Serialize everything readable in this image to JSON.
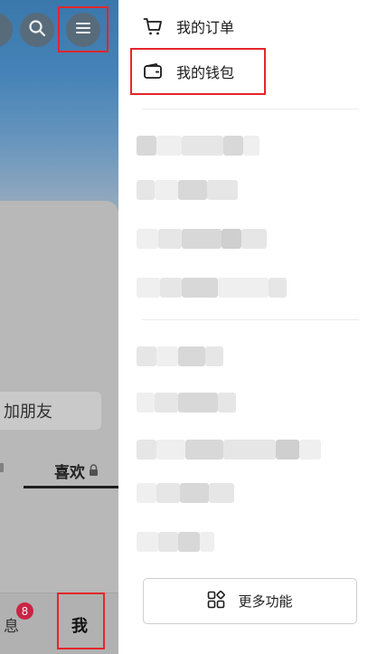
{
  "left_page": {
    "add_friend_text": "加朋友",
    "liked_tab_label": "喜欢",
    "nav_messages_partial": "息",
    "messages_badge_count": "8",
    "nav_me_label": "我",
    "icons": {
      "search": "search-icon",
      "menu": "menu-icon",
      "lock": "lock-icon"
    }
  },
  "drawer": {
    "items": [
      {
        "label": "我的订单",
        "icon": "cart-icon"
      },
      {
        "label": "我的钱包",
        "icon": "wallet-icon"
      }
    ],
    "more_button_label": "更多功能",
    "more_button_icon": "grid-apps-icon"
  },
  "colors": {
    "highlight_box": "#e4262a",
    "badge_red": "#d8264a"
  }
}
